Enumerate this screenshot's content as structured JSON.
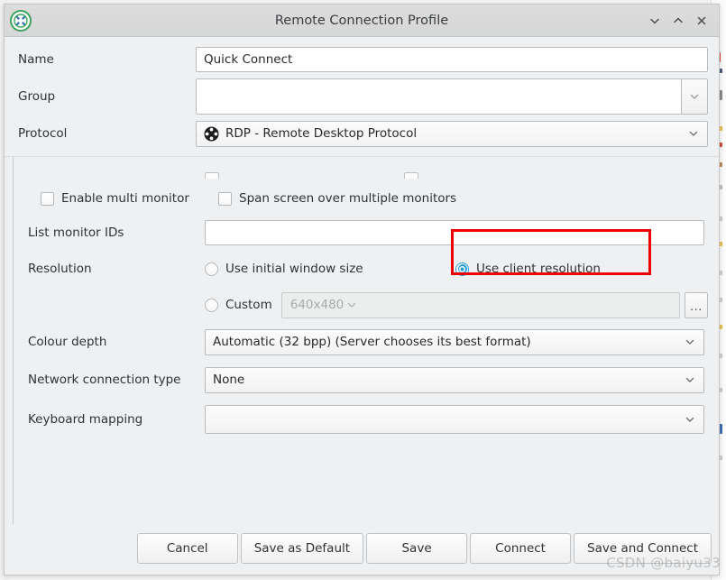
{
  "window": {
    "title": "Remote Connection Profile",
    "app_icon": "remmina-icon",
    "controls": [
      {
        "name": "minimize-button",
        "glyph": "chevron-down-icon"
      },
      {
        "name": "maximize-button",
        "glyph": "chevron-up-icon"
      },
      {
        "name": "close-button",
        "glyph": "close-icon"
      }
    ]
  },
  "header": {
    "name": {
      "label": "Name",
      "value": "Quick Connect"
    },
    "group": {
      "label": "Group",
      "value": ""
    },
    "protocol": {
      "label": "Protocol",
      "value": "RDP - Remote Desktop Protocol",
      "icon": "rdp-protocol-icon"
    }
  },
  "settings": {
    "multi_monitor": {
      "label": "Enable multi monitor",
      "checked": false
    },
    "span_screen": {
      "label": "Span screen over multiple monitors",
      "checked": false
    },
    "monitor_ids": {
      "label": "List monitor IDs",
      "value": ""
    },
    "resolution": {
      "label": "Resolution",
      "option_initial": {
        "label": "Use initial window size",
        "selected": false
      },
      "option_client": {
        "label": "Use client resolution",
        "selected": true
      },
      "option_custom": {
        "label": "Custom",
        "selected": false
      },
      "custom_placeholder": "640x480",
      "browse_button": "..."
    },
    "colour_depth": {
      "label": "Colour depth",
      "value": "Automatic (32 bpp) (Server chooses its best format)"
    },
    "network_type": {
      "label": "Network connection type",
      "value": "None"
    },
    "keyboard_mapping": {
      "label": "Keyboard mapping",
      "value": ""
    }
  },
  "footer": {
    "buttons": [
      {
        "name": "cancel-button",
        "label": "Cancel"
      },
      {
        "name": "save-as-default-button",
        "label": "Save as Default"
      },
      {
        "name": "save-button",
        "label": "Save"
      },
      {
        "name": "connect-button",
        "label": "Connect"
      },
      {
        "name": "save-and-connect-button",
        "label": "Save and Connect"
      }
    ]
  },
  "annotation": {
    "highlight_color": "#ee0000",
    "target": "Use client resolution"
  },
  "watermark": {
    "text": "CSDN @baiyu33"
  }
}
